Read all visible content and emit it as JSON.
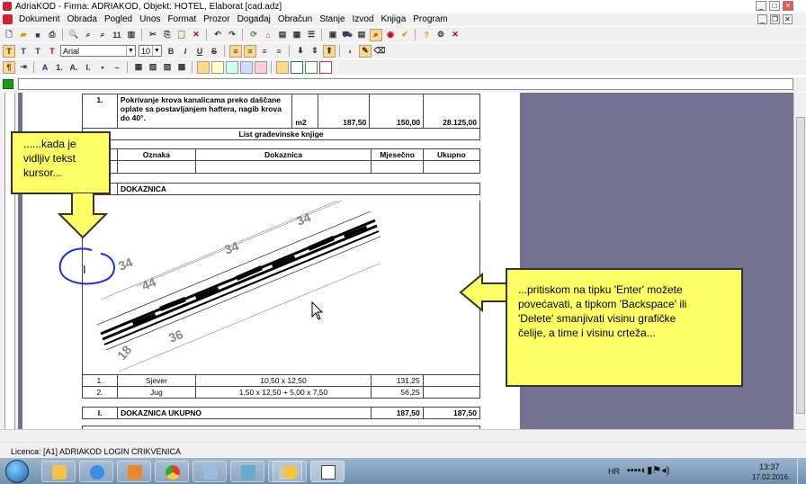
{
  "window": {
    "title": "AdriaKOD - Firma: ADRIAKOD,  Objekt: HOTEL, Elaborat [cad.adz]"
  },
  "menu": [
    "Dokument",
    "Obrada",
    "Pogled",
    "Unos",
    "Format",
    "Prozor",
    "Događaj",
    "Obračun",
    "Stanje",
    "Izvod",
    "Knjiga",
    "Program"
  ],
  "format": {
    "font": "Arial",
    "size": "10"
  },
  "items": {
    "row1": {
      "num": "1.",
      "desc": "Pokrivanje krova kanalicama preko daščane oplate sa postavljanjem haftera, nagib krova do 40°.",
      "unit": "m2",
      "qty": "187,50",
      "price": "150,00",
      "total": "28.125,00"
    }
  },
  "list": {
    "title": "List građevinske knjige",
    "cols": [
      "Oznaka",
      "Dokaznica",
      "Mjesečno",
      "Ukupno"
    ]
  },
  "section": {
    "num": "I.",
    "name": "DOKAZNICA"
  },
  "drawing": {
    "dims": [
      "34",
      "34",
      "34",
      "44",
      "36",
      "18"
    ]
  },
  "measure_rows": [
    {
      "num": "1.",
      "name": "Sjever",
      "formula": "10,50 x 12,50",
      "month": "131,25",
      "total": ""
    },
    {
      "num": "2.",
      "name": "Jug",
      "formula": "1,50 x 12,50 + 5,00 x 7,50",
      "month": "56,25",
      "total": ""
    }
  ],
  "summary": {
    "num": "I.",
    "name": "DOKAZNICA UKUPNO",
    "month": "187,50",
    "total": "187,50"
  },
  "cursor_char": "I",
  "callouts": {
    "left": [
      "......kada je",
      "vidljiv tekst",
      "kursor..."
    ],
    "right": [
      "...pritiskom na tipku 'Enter' možete",
      "povećavati, a tipkom 'Backspace' ili",
      "'Delete' smanjivati visinu grafičke",
      "čelije, a time i visinu crteža..."
    ]
  },
  "status": {
    "licence": "Licenca: [A1] ADRIAKOD LOGIN CRIKVENICA"
  },
  "tray": {
    "lang": "HR",
    "time": "13:37",
    "date": "17.02.2016."
  }
}
